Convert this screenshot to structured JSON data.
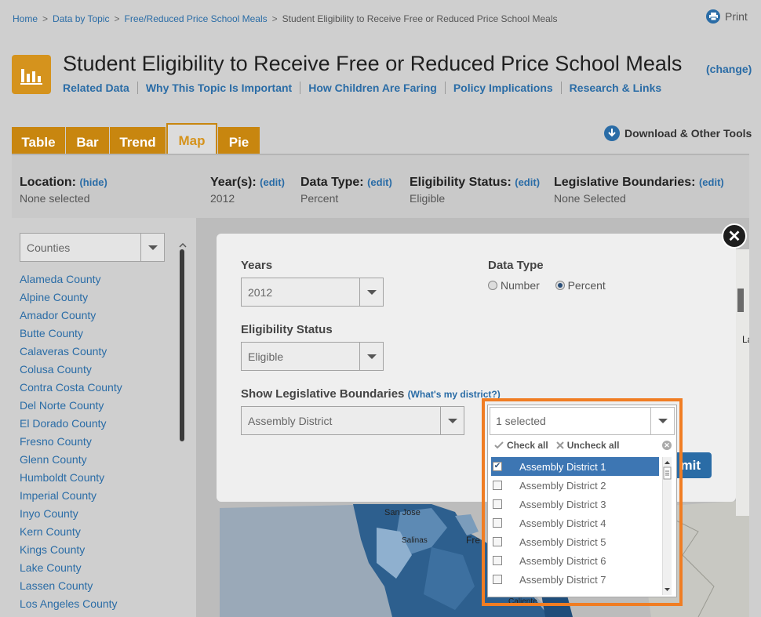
{
  "breadcrumb": [
    "Home",
    "Data by Topic",
    "Free/Reduced Price School Meals",
    "Student Eligibility to Receive Free or Reduced Price School Meals"
  ],
  "breadcrumb_sep": ">",
  "print_label": "Print",
  "title": "Student Eligibility to Receive Free or Reduced Price School Meals",
  "change_label": "(change)",
  "subnav": [
    "Related Data",
    "Why This Topic Is Important",
    "How Children Are Faring",
    "Policy Implications",
    "Research & Links"
  ],
  "tabs": [
    "Table",
    "Bar",
    "Trend",
    "Map",
    "Pie"
  ],
  "active_tab": "Map",
  "download_label": "Download & Other Tools",
  "filters": {
    "location": {
      "label": "Location:",
      "action": "(hide)",
      "value": "None selected"
    },
    "years": {
      "label": "Year(s):",
      "action": "(edit)",
      "value": "2012"
    },
    "data_type": {
      "label": "Data Type:",
      "action": "(edit)",
      "value": "Percent"
    },
    "eligibility": {
      "label": "Eligibility Status:",
      "action": "(edit)",
      "value": "Eligible"
    },
    "legislative": {
      "label": "Legislative Boundaries:",
      "action": "(edit)",
      "value": "None Selected"
    }
  },
  "sidebar": {
    "select_value": "Counties",
    "counties": [
      "Alameda County",
      "Alpine County",
      "Amador County",
      "Butte County",
      "Calaveras County",
      "Colusa County",
      "Contra Costa County",
      "Del Norte County",
      "El Dorado County",
      "Fresno County",
      "Glenn County",
      "Humboldt County",
      "Imperial County",
      "Inyo County",
      "Kern County",
      "Kings County",
      "Lake County",
      "Lassen County",
      "Los Angeles County"
    ]
  },
  "modal": {
    "years_label": "Years",
    "years_value": "2012",
    "data_type_label": "Data Type",
    "data_type_options": [
      "Number",
      "Percent"
    ],
    "data_type_selected": "Percent",
    "eligibility_label": "Eligibility Status",
    "eligibility_value": "Eligible",
    "boundaries_label": "Show Legislative Boundaries",
    "whats_my_district": "(What's my district?)",
    "boundaries_value": "Assembly District",
    "submit_label_visible": "mit"
  },
  "district_dropdown": {
    "summary": "1 selected",
    "check_all": "Check all",
    "uncheck_all": "Uncheck all",
    "options": [
      {
        "label": "Assembly District 1",
        "checked": true
      },
      {
        "label": "Assembly District 2",
        "checked": false
      },
      {
        "label": "Assembly District 3",
        "checked": false
      },
      {
        "label": "Assembly District 4",
        "checked": false
      },
      {
        "label": "Assembly District 5",
        "checked": false
      },
      {
        "label": "Assembly District 6",
        "checked": false
      },
      {
        "label": "Assembly District 7",
        "checked": false
      }
    ]
  },
  "map_labels": [
    "San Jose",
    "Salinas",
    "Fre",
    "Caliente",
    "La"
  ],
  "colors": {
    "accent": "#c8860f",
    "link": "#2a6ca6",
    "selected": "#3d76b3",
    "highlight": "#f07d23",
    "map_dark": "#2d5f8e"
  }
}
